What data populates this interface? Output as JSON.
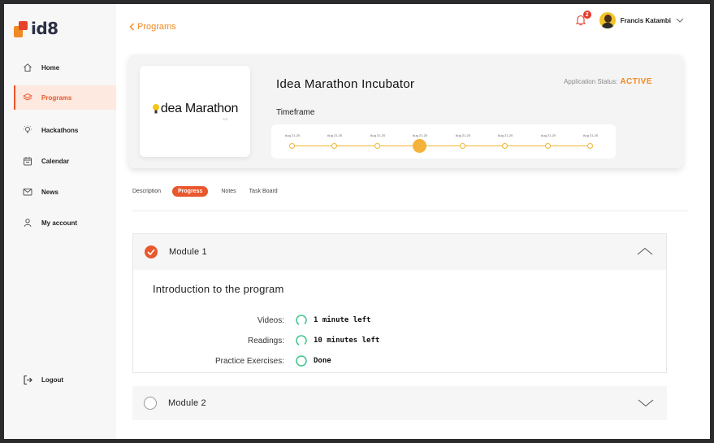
{
  "app": {
    "logo_text": "id8"
  },
  "sidebar": {
    "items": [
      {
        "label": "Home",
        "icon": "home-icon"
      },
      {
        "label": "Programs",
        "icon": "layers-icon",
        "active": true
      },
      {
        "label": "Hackathons",
        "icon": "bulb-icon"
      },
      {
        "label": "Calendar",
        "icon": "calendar-icon"
      },
      {
        "label": "News",
        "icon": "mail-icon"
      },
      {
        "label": "My account",
        "icon": "user-icon"
      }
    ],
    "logout_label": "Logout"
  },
  "header": {
    "back_label": "Programs",
    "notifications_count": "2",
    "user_name": "Francis Katambi"
  },
  "program": {
    "logo_text": "dea Marathon",
    "logo_sub": "2.0",
    "title": "Idea Marathon Incubator",
    "status_label": "Application Status:",
    "status_value": "ACTIVE",
    "timeframe_label": "Timeframe",
    "timeline": [
      {
        "label": "Aug 21-20"
      },
      {
        "label": "Aug 21-20"
      },
      {
        "label": "Aug 21-20"
      },
      {
        "label": "Aug 21-20",
        "current": true
      },
      {
        "label": "Aug 21-20"
      },
      {
        "label": "Aug 21-20"
      },
      {
        "label": "Aug 21-20"
      },
      {
        "label": "Aug 21-20"
      }
    ]
  },
  "tabs": [
    {
      "label": "Description"
    },
    {
      "label": "Progress",
      "active": true
    },
    {
      "label": "Notes"
    },
    {
      "label": "Task Board"
    }
  ],
  "modules": [
    {
      "title": "Module 1",
      "completed": true,
      "expanded": true,
      "intro": "Introduction to the program",
      "rows": [
        {
          "label": "Videos:",
          "value": "1 minute left"
        },
        {
          "label": "Readings:",
          "value": "10 minutes left"
        },
        {
          "label": "Practice Exercises:",
          "value": "Done"
        }
      ]
    },
    {
      "title": "Module 2",
      "completed": false,
      "expanded": false
    }
  ],
  "colors": {
    "accent": "#e9572d",
    "orange": "#f08a24",
    "timeline": "#f0b430",
    "progress_ring": "#3cc48a"
  }
}
